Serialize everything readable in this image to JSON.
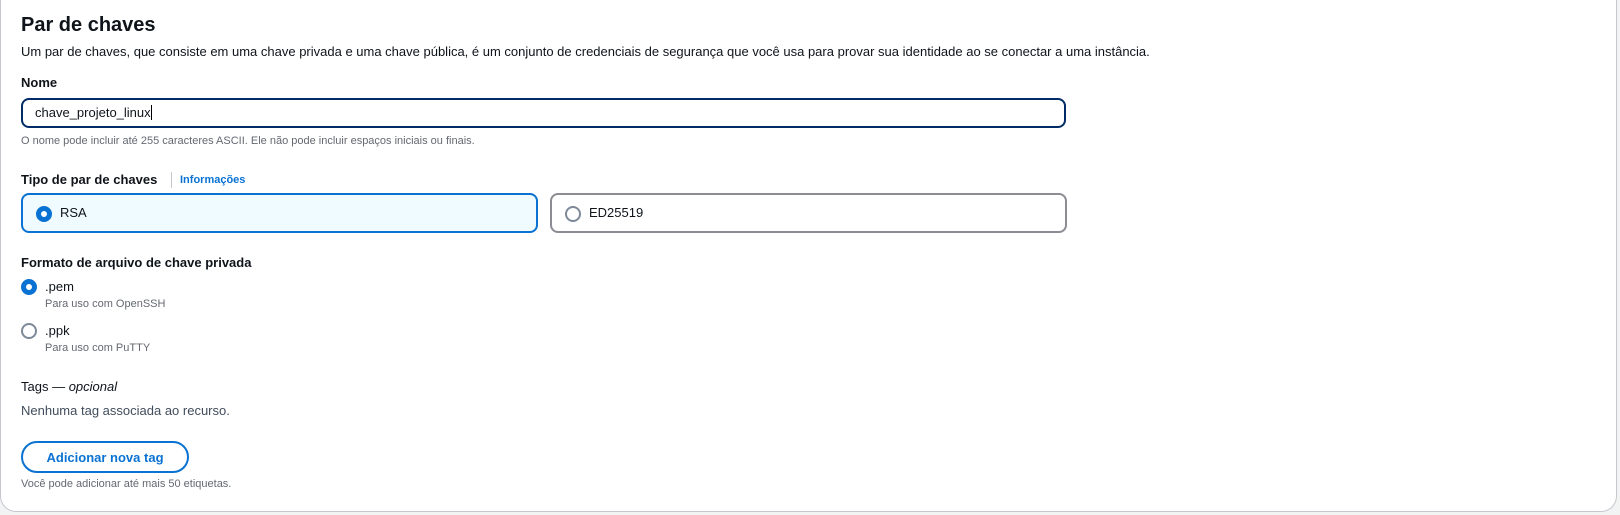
{
  "section": {
    "title": "Par de chaves",
    "description": "Um par de chaves, que consiste em uma chave privada e uma chave pública, é um conjunto de credenciais de segurança que você usa para provar sua identidade ao se conectar a uma instância."
  },
  "name_field": {
    "label": "Nome",
    "value": "chave_projeto_linux",
    "hint": "O nome pode incluir até 255 caracteres ASCII. Ele não pode incluir espaços iniciais ou finais."
  },
  "key_type": {
    "label": "Tipo de par de chaves",
    "info_link": "Informações",
    "options": [
      {
        "label": "RSA",
        "selected": true
      },
      {
        "label": "ED25519",
        "selected": false
      }
    ]
  },
  "file_format": {
    "label": "Formato de arquivo de chave privada",
    "options": [
      {
        "label": ".pem",
        "description": "Para uso com OpenSSH",
        "selected": true
      },
      {
        "label": ".ppk",
        "description": "Para uso com PuTTY",
        "selected": false
      }
    ]
  },
  "tags": {
    "label": "Tags —",
    "label_optional": "opcional",
    "empty_text": "Nenhuma tag associada ao recurso.",
    "add_button": "Adicionar nova tag",
    "hint": "Você pode adicionar até mais 50 etiquetas."
  },
  "colors": {
    "accent": "#0972d3",
    "focus_border": "#002b66",
    "selected_tile_bg": "#f0fbff"
  }
}
